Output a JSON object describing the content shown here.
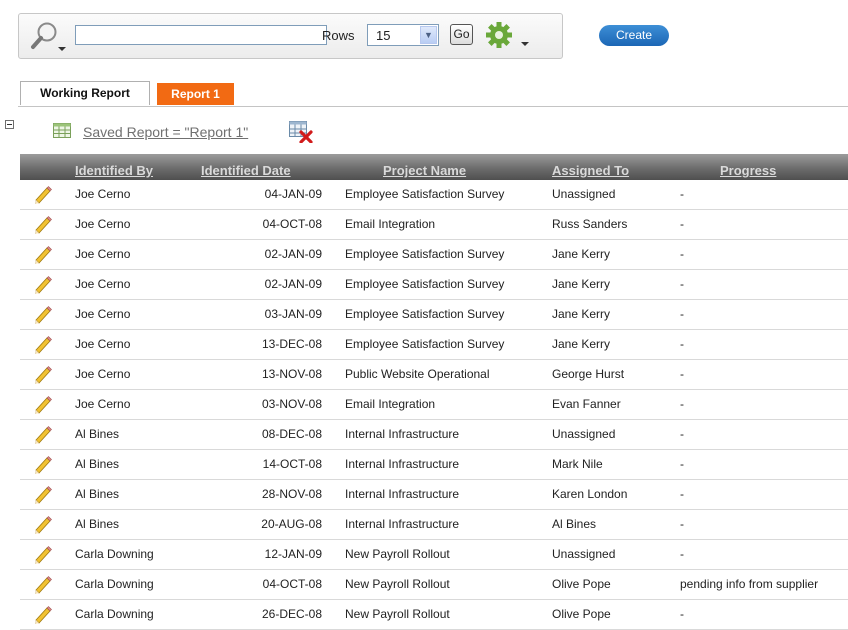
{
  "toolbar": {
    "search_value": "",
    "rows_label": "Rows",
    "rows_value": "15",
    "go_label": "Go",
    "create_label": "Create"
  },
  "tabs": [
    {
      "label": "Working Report"
    },
    {
      "label": "Report 1"
    }
  ],
  "saved_report": "Saved Report = \"Report 1\"",
  "colors": {
    "accent_tab": "#f26a13",
    "create_button": "#2f7fcc"
  },
  "icons": [
    "search-icon",
    "gear-icon",
    "collapse-icon",
    "saved-report-grid-icon",
    "delete-report-icon",
    "edit-pencil-icon"
  ],
  "table": {
    "headers": [
      "Identified By",
      "Identified Date",
      "Project Name",
      "Assigned To",
      "Progress"
    ],
    "rows": [
      {
        "by": "Joe Cerno",
        "date": "04-JAN-09",
        "project": "Employee Satisfaction Survey",
        "assigned": "Unassigned",
        "progress": "-"
      },
      {
        "by": "Joe Cerno",
        "date": "04-OCT-08",
        "project": "Email Integration",
        "assigned": "Russ Sanders",
        "progress": "-"
      },
      {
        "by": "Joe Cerno",
        "date": "02-JAN-09",
        "project": "Employee Satisfaction Survey",
        "assigned": "Jane Kerry",
        "progress": "-"
      },
      {
        "by": "Joe Cerno",
        "date": "02-JAN-09",
        "project": "Employee Satisfaction Survey",
        "assigned": "Jane Kerry",
        "progress": "-"
      },
      {
        "by": "Joe Cerno",
        "date": "03-JAN-09",
        "project": "Employee Satisfaction Survey",
        "assigned": "Jane Kerry",
        "progress": "-"
      },
      {
        "by": "Joe Cerno",
        "date": "13-DEC-08",
        "project": "Employee Satisfaction Survey",
        "assigned": "Jane Kerry",
        "progress": "-"
      },
      {
        "by": "Joe Cerno",
        "date": "13-NOV-08",
        "project": "Public Website Operational",
        "assigned": "George Hurst",
        "progress": "-"
      },
      {
        "by": "Joe Cerno",
        "date": "03-NOV-08",
        "project": "Email Integration",
        "assigned": "Evan Fanner",
        "progress": "-"
      },
      {
        "by": "Al Bines",
        "date": "08-DEC-08",
        "project": "Internal Infrastructure",
        "assigned": "Unassigned",
        "progress": "-"
      },
      {
        "by": "Al Bines",
        "date": "14-OCT-08",
        "project": "Internal Infrastructure",
        "assigned": "Mark Nile",
        "progress": "-"
      },
      {
        "by": "Al Bines",
        "date": "28-NOV-08",
        "project": "Internal Infrastructure",
        "assigned": "Karen London",
        "progress": "-"
      },
      {
        "by": "Al Bines",
        "date": "20-AUG-08",
        "project": "Internal Infrastructure",
        "assigned": "Al Bines",
        "progress": "-"
      },
      {
        "by": "Carla Downing",
        "date": "12-JAN-09",
        "project": "New Payroll Rollout",
        "assigned": "Unassigned",
        "progress": "-"
      },
      {
        "by": "Carla Downing",
        "date": "04-OCT-08",
        "project": "New Payroll Rollout",
        "assigned": "Olive Pope",
        "progress": "pending info from supplier"
      },
      {
        "by": "Carla Downing",
        "date": "26-DEC-08",
        "project": "New Payroll Rollout",
        "assigned": "Olive Pope",
        "progress": "-"
      }
    ]
  }
}
